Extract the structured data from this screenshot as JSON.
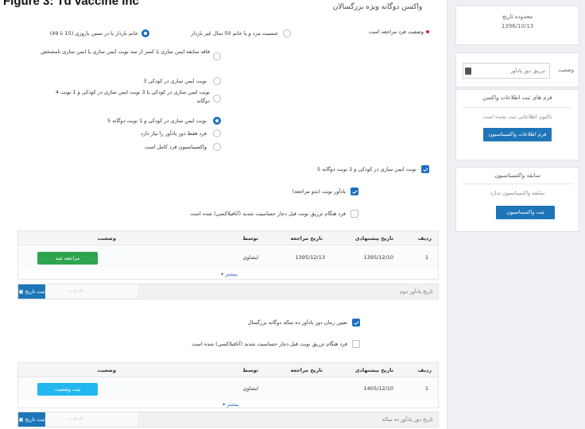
{
  "figure_title": "Figure 3: Td vaccine inc",
  "main_title": "واکسن دوگانه ویژه بزرگسالان",
  "status_text": "وضعیت فرد مراجعه است",
  "options": {
    "opt_a": "جنسیت مرد و یا خانم 50 سال غیر باردار",
    "opt_b": "خانم باردار یا در سنین باروری (15 تا 49)",
    "opt_c": "فاقد سابقه ایمن سازی یا کمتر از سه نوبت ایمن سازی یا ایمن سازی نامشخص",
    "opt_d": "3 نوبت ایمن سازی در کودکی",
    "opt_e": "4 نوبت ایمن سازی در کودکی یا 3 نوبت ایمن سازی در کودکی و 1 نوبت دوگانه",
    "opt_f": "5 نوبت ایمن سازی در کودکی و 1 نوبت دوگانه",
    "opt_g": "فرد فقط دوز یادآور را نیاز دارد",
    "opt_h": "واکسیناسیون فرد کامل است"
  },
  "checks": {
    "chk_a": "5 نوبت ایمن سازی در کودکی و 1 نوبت دوگانه",
    "chk_b": "یادآور نوبت (بدو مراجعه)",
    "chk_c": "فرد هنگام تزریق نوبت قبل دچار حساسیت شدید (آنافیلاکسی) شده است"
  },
  "table1": {
    "headers": [
      "ردیف",
      "تاریخ پیشنهادی",
      "تاریخ مراجعه",
      "توسط",
      "وضعیت"
    ],
    "rows": [
      [
        "1",
        "1395/12/10",
        "1395/12/13",
        "ایشاوی",
        "مراجعه شد"
      ]
    ],
    "more": "بیشتر"
  },
  "footer1": {
    "label": "تاریخ یادآور دوم",
    "placeholder": "----/--/--",
    "button": "ثبت تاریخ"
  },
  "section2": {
    "chk_a": "تعیین زمان دوز یادآور ده ساله دوگانه بزرگسال",
    "chk_b": "فرد هنگام تزریق نوبت قبل دچار حساسیت شدید (آنافیلاکسی) شده است"
  },
  "table2": {
    "headers": [
      "ردیف",
      "تاریخ پیشنهادی",
      "تاریخ مراجعه",
      "توسط",
      "وضعیت"
    ],
    "rows": [
      [
        "1",
        "1405/12/10",
        "",
        "ایشاوی",
        "ثبت وضعیت"
      ]
    ],
    "more": "بیشتر"
  },
  "footer2": {
    "label": "تاریخ دوز یادآور ده ساله",
    "placeholder": "----/--/--",
    "button": "ثبت تاریخ"
  },
  "sidebar": {
    "date_card": {
      "title": "محدوده تاریخ",
      "value": "1396/10/13"
    },
    "vaccine_select": {
      "label": "وضعیت",
      "value": "تزریق دوز یادآور"
    },
    "form_card": {
      "title": "فرم های ثبت اطلاعات واکسن",
      "text": "تاکنون اطلاعاتی ثبت نشده است",
      "button": "فرم اطلاعات واکسیناسیون"
    },
    "history_card": {
      "title": "سابقه واکسیناسیون",
      "text": "سابقه واکسیناسیون ندارد",
      "button": "ثبت واکسیناسیون"
    }
  },
  "colors": {
    "primary": "#1e75b8",
    "success": "#2fa44f",
    "info": "#22b8ef",
    "danger": "#d9232e"
  }
}
